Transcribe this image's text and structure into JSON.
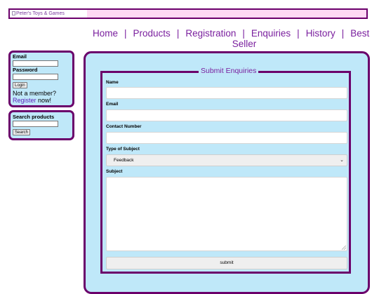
{
  "header": {
    "logo_alt": "Peter's Toys & Games"
  },
  "nav": {
    "items": [
      "Home",
      "Products",
      "Registration",
      "Enquiries",
      "History",
      "Best Seller"
    ]
  },
  "login": {
    "email_label": "Email",
    "email_value": "",
    "password_label": "Password",
    "password_value": "",
    "login_button": "Login",
    "member_prompt": "Not a member?",
    "register_link": "Register",
    "register_suffix": " now!"
  },
  "search": {
    "label": "Search products",
    "value": "",
    "button": "Search"
  },
  "form": {
    "legend": "Submit Enquiries",
    "name_label": "Name",
    "name_value": "",
    "email_label": "Email",
    "email_value": "",
    "contact_label": "Contact Number",
    "contact_value": "",
    "subject_type_label": "Type of Subject",
    "subject_type_value": "Feedback",
    "subject_label": "Subject",
    "subject_value": "",
    "submit_label": "submit"
  },
  "colors": {
    "border": "#6b006b",
    "panel_bg": "#bfe8f9",
    "banner_bg": "#ffd9f3",
    "link": "#7a1f9e"
  }
}
